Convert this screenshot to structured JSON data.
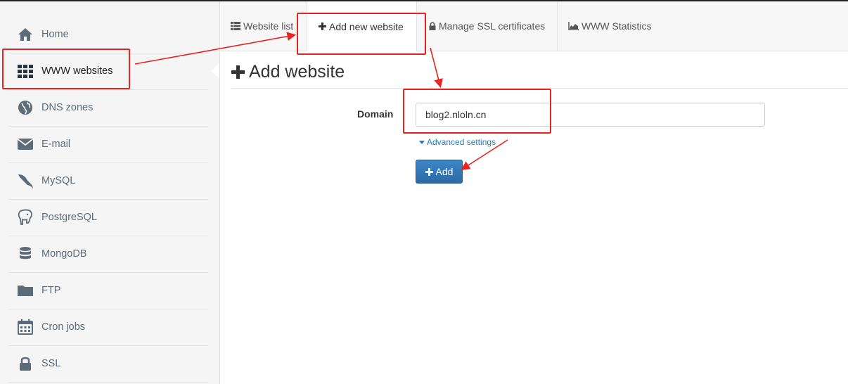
{
  "sidebar": {
    "items": [
      {
        "label": "Home",
        "icon": "home-icon"
      },
      {
        "label": "WWW websites",
        "icon": "grid-icon"
      },
      {
        "label": "DNS zones",
        "icon": "globe-icon"
      },
      {
        "label": "E-mail",
        "icon": "envelope-icon"
      },
      {
        "label": "MySQL",
        "icon": "dolphin-icon"
      },
      {
        "label": "PostgreSQL",
        "icon": "elephant-icon"
      },
      {
        "label": "MongoDB",
        "icon": "database-icon"
      },
      {
        "label": "FTP",
        "icon": "folder-icon"
      },
      {
        "label": "Cron jobs",
        "icon": "calendar-icon"
      },
      {
        "label": "SSL",
        "icon": "lock-icon"
      }
    ],
    "active_index": 1
  },
  "tabs": [
    {
      "label": "Website list",
      "icon": "list-icon"
    },
    {
      "label": "Add new website",
      "icon": "plus-icon"
    },
    {
      "label": "Manage SSL certificates",
      "icon": "lock-icon"
    },
    {
      "label": "WWW Statistics",
      "icon": "area-chart-icon"
    }
  ],
  "main": {
    "title": "Add website",
    "domain_label": "Domain",
    "domain_value": "blog2.nloln.cn",
    "advanced_settings": "Advanced settings",
    "add_button": "Add"
  },
  "colors": {
    "accent": "#2b6aa6",
    "link": "#2a7ab0",
    "annotation": "#e8231f",
    "sidebar_icon": "#5f6b77"
  }
}
